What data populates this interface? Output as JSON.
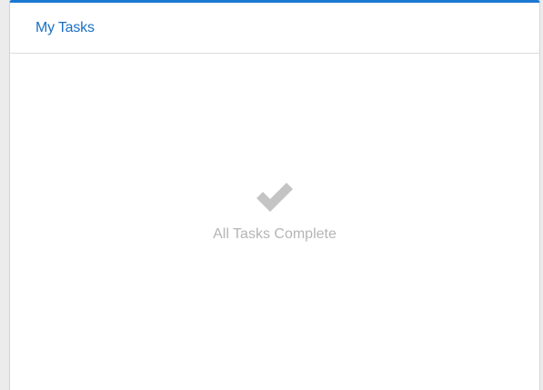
{
  "widget": {
    "title": "My Tasks",
    "accent_color": "#1b78d0",
    "title_color": "#1a6fc4"
  },
  "empty_state": {
    "icon": "checkmark-icon",
    "message": "All Tasks Complete",
    "icon_color": "#c4c4c4",
    "text_color": "#b5b5b5"
  }
}
